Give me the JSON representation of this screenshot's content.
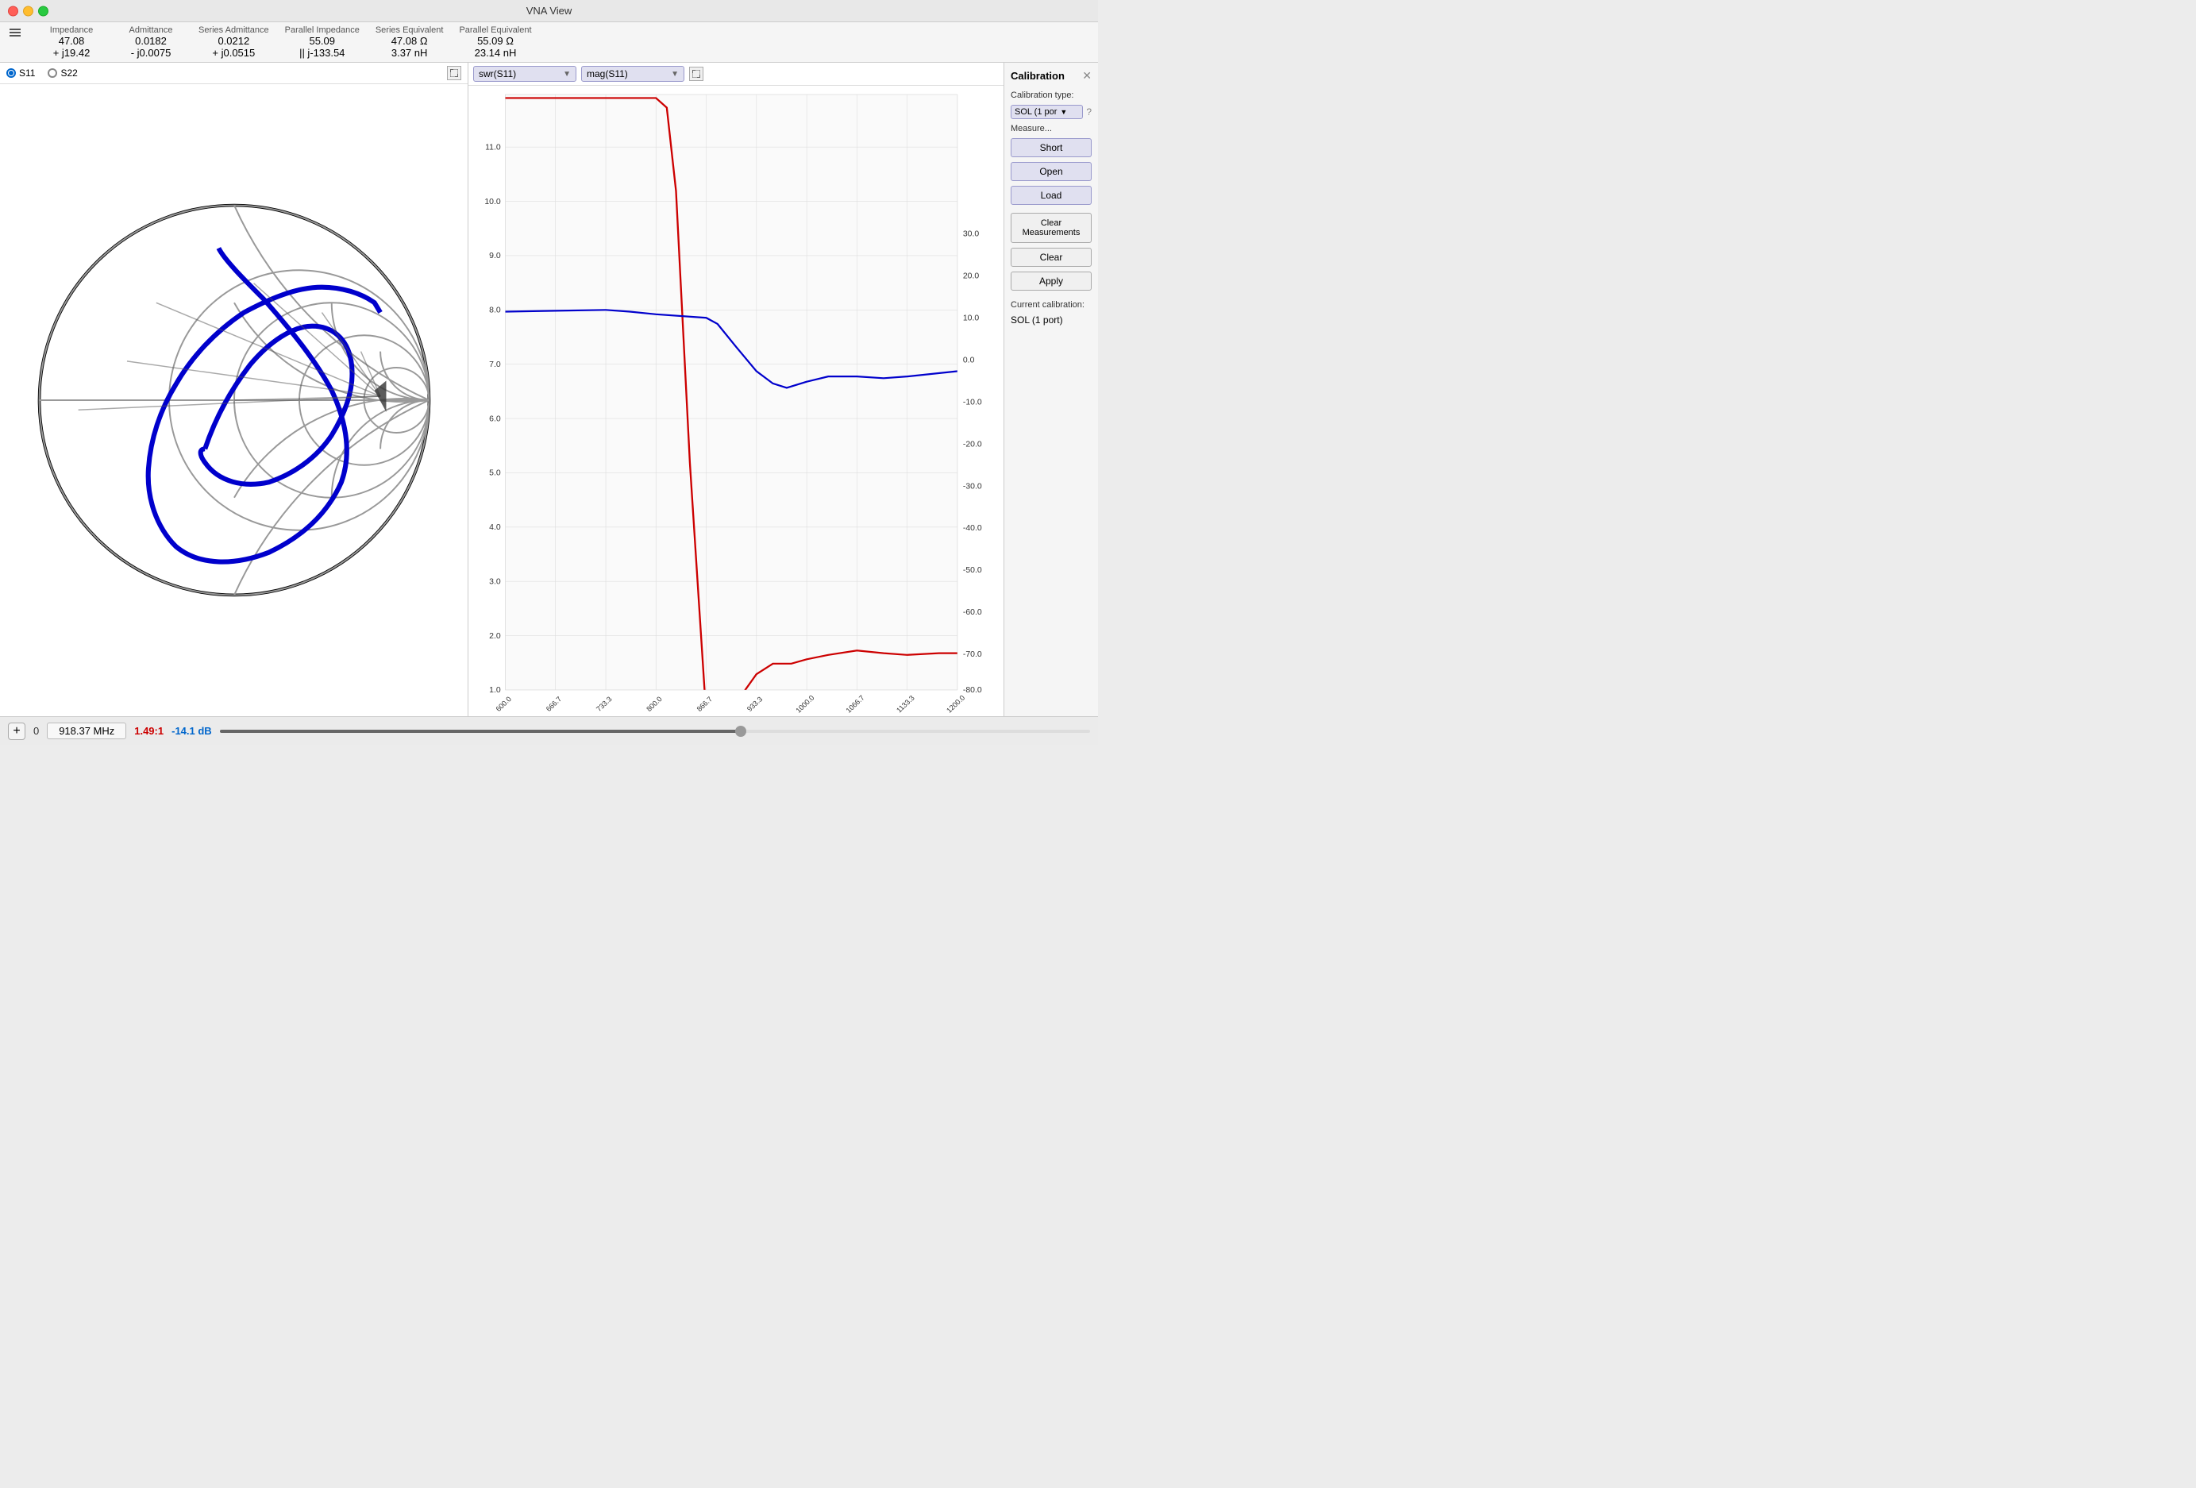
{
  "titleBar": {
    "title": "VNA View"
  },
  "metrics": {
    "hamburger": "menu",
    "impedance": {
      "label": "Impedance",
      "value": "47.08",
      "subvalue": "+ j19.42"
    },
    "admittance": {
      "label": "Admittance",
      "value": "0.0182",
      "subvalue": "- j0.0075"
    },
    "seriesAdmittance": {
      "label": "Series Admittance",
      "value": "0.0212",
      "subvalue": "+ j0.0515"
    },
    "parallelImpedance": {
      "label": "Parallel Impedance",
      "value": "55.09",
      "subvalue": "|| j-133.54"
    },
    "seriesEquivalent": {
      "label": "Series Equivalent",
      "value": "47.08 Ω",
      "subvalue": "3.37 nH"
    },
    "parallelEquivalent": {
      "label": "Parallel Equivalent",
      "value": "55.09 Ω",
      "subvalue": "23.14 nH"
    }
  },
  "smithChart": {
    "s11Label": "S11",
    "s22Label": "S22",
    "s11Active": true
  },
  "graph": {
    "dropdown1": "swr(S11)",
    "dropdown2": "mag(S11)",
    "xAxisLabels": [
      "600.0",
      "666.7",
      "733.3",
      "800.0",
      "866.7",
      "933.3",
      "1000.0",
      "1066.7",
      "1133.3",
      "1200.0"
    ],
    "leftYAxisLabels": [
      "1.0",
      "2.0",
      "3.0",
      "4.0",
      "5.0",
      "6.0",
      "7.0",
      "8.0",
      "9.0",
      "10.0",
      "11.0"
    ],
    "rightYAxisLabels": [
      "-80.0",
      "-70.0",
      "-60.0",
      "-50.0",
      "-40.0",
      "-30.0",
      "-20.0",
      "-10.0",
      "0.0",
      "10.0",
      "20.0",
      "30.0"
    ]
  },
  "calibration": {
    "title": "Calibration",
    "calTypeLabel": "Calibration type:",
    "calTypeValue": "SOL (1 por",
    "measureLabel": "Measure...",
    "shortLabel": "Short",
    "openLabel": "Open",
    "loadLabel": "Load",
    "clearMeasurementsLabel": "Clear Measurements",
    "clearLabel": "Clear",
    "applyLabel": "Apply",
    "currentCalLabel": "Current calibration:",
    "currentCalValue": "SOL (1 port)"
  },
  "bottomBar": {
    "addLabel": "+",
    "channelNum": "0",
    "freqValue": "918.37 MHz",
    "swrValue": "1.49:1",
    "dbValue": "-14.1 dB",
    "sliderMin": "0",
    "sliderMax": "100",
    "sliderValue": "60"
  }
}
